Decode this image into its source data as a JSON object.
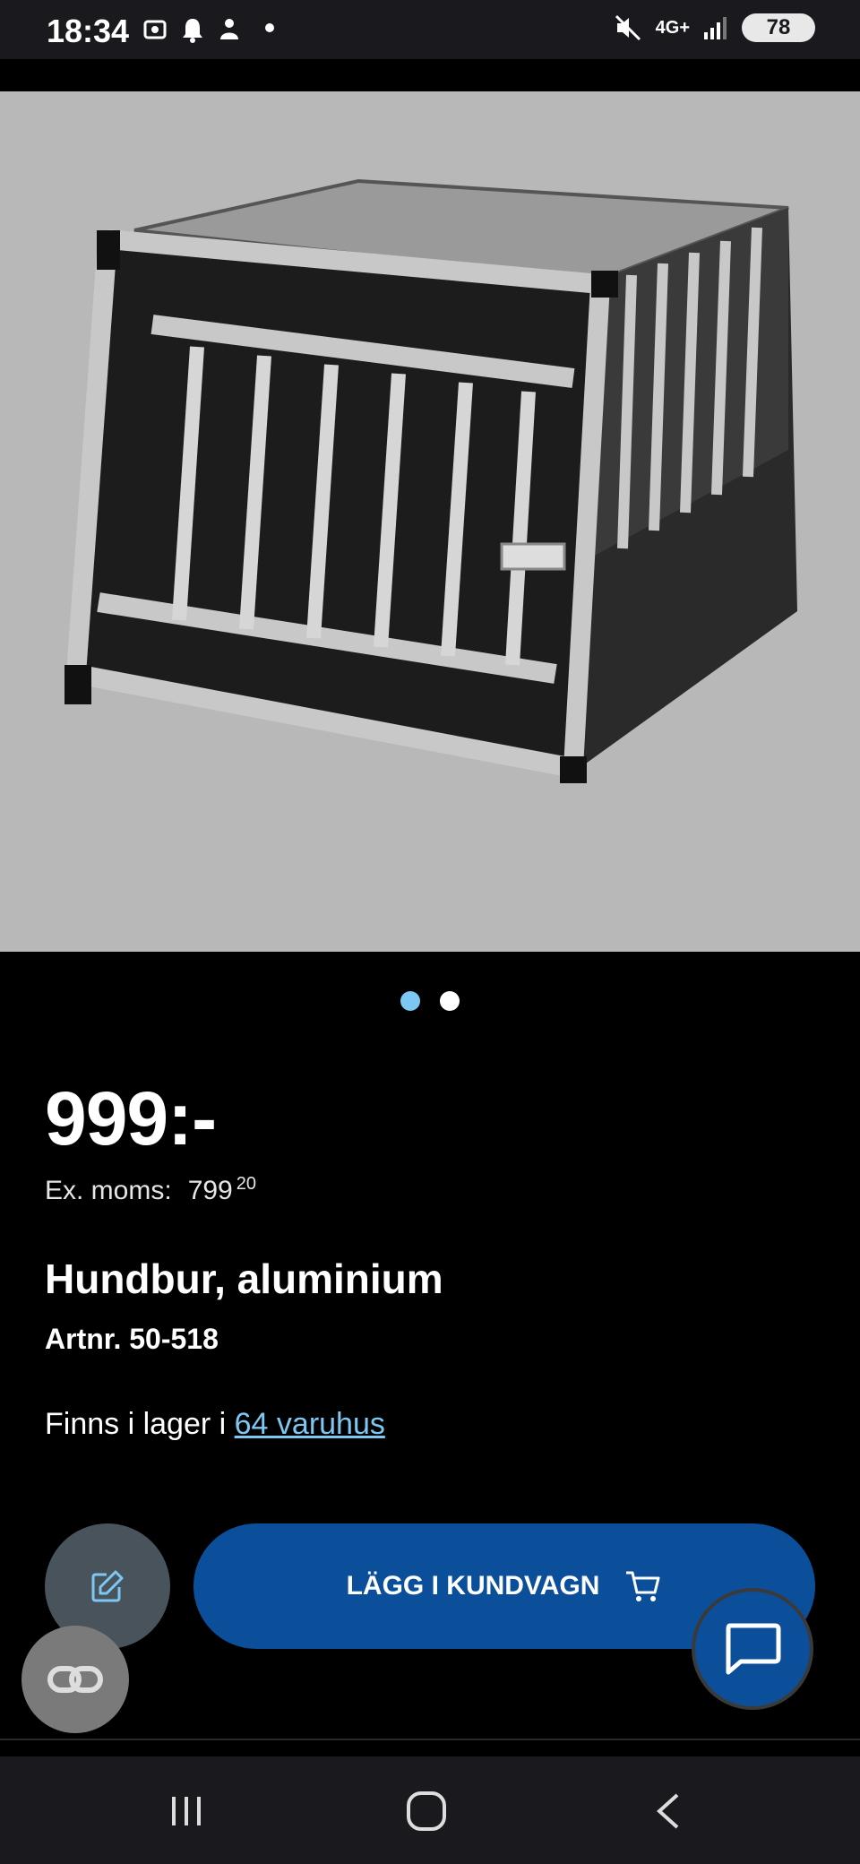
{
  "status_bar": {
    "time": "18:34",
    "network": "4G+",
    "battery": "78"
  },
  "carousel": {
    "count": 2,
    "active_index": 0
  },
  "product": {
    "price": "999:-",
    "ex_moms_label": "Ex. moms:",
    "ex_moms_value": "799",
    "ex_moms_decimals": "20",
    "name": "Hundbur, aluminium",
    "article_number": "Artnr. 50-518",
    "stock_prefix": "Finns i lager i ",
    "stock_link": "64 varuhus"
  },
  "actions": {
    "add_to_cart_label": "LÄGG I KUNDVAGN"
  },
  "colors": {
    "accent": "#7cc8f2",
    "primary_button": "#0b4f9b",
    "background": "#000000"
  }
}
